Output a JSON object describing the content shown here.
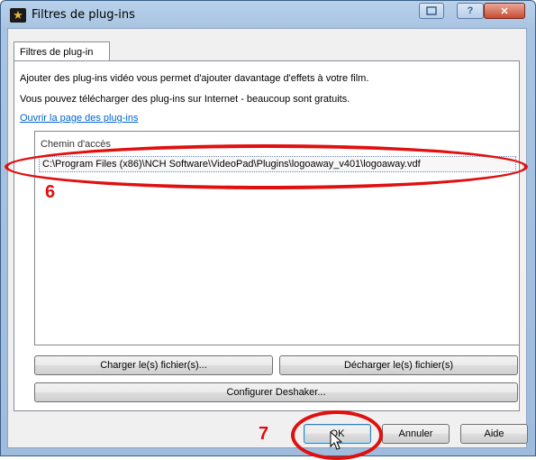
{
  "window": {
    "title": "Filtres de plug-ins",
    "icon": "star-app-icon"
  },
  "tab": {
    "label": "Filtres de plug-in"
  },
  "description": {
    "line1": "Ajouter des plug-ins vidéo vous permet d'ajouter davantage d'effets à votre film.",
    "line2": "Vous pouvez télécharger des plug-ins sur Internet - beaucoup sont gratuits.",
    "link": "Ouvrir la page des plug-ins"
  },
  "plugin_list": {
    "header": "Chemin d'accès",
    "items": [
      "C:\\Program Files (x86)\\NCH Software\\VideoPad\\Plugins\\logoaway_v401\\logoaway.vdf"
    ]
  },
  "buttons": {
    "load": "Charger le(s) fichier(s)...",
    "unload": "Décharger le(s) fichier(s)",
    "deshaker": "Configurer Deshaker...",
    "ok": "OK",
    "cancel": "Annuler",
    "help": "Aide"
  },
  "annotations": {
    "step_6": "6",
    "step_7": "7",
    "color": "#e01010"
  }
}
